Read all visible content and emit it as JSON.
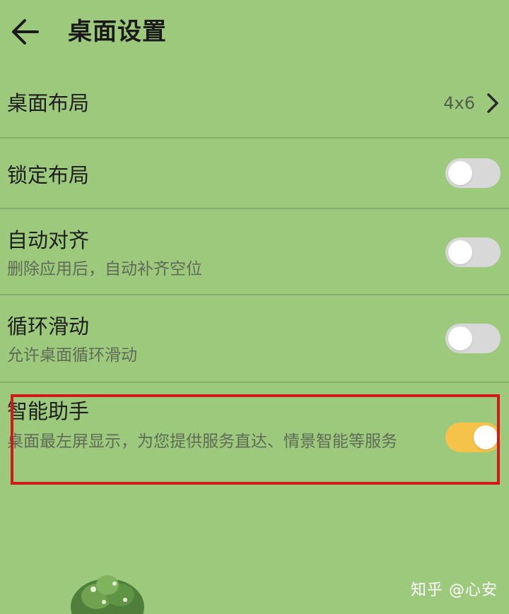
{
  "header": {
    "title": "桌面设置",
    "back_icon": "arrow-left-icon"
  },
  "settings": [
    {
      "label": "桌面布局",
      "value": "4x6",
      "icon": "chevron-right-icon"
    },
    {
      "label": "锁定布局",
      "toggle": false
    },
    {
      "label": "自动对齐",
      "subtitle": "删除应用后，自动补齐空位",
      "toggle": false
    },
    {
      "label": "循环滑动",
      "subtitle": "允许桌面循环滑动",
      "toggle": false
    },
    {
      "label": "智能助手",
      "subtitle": "桌面最左屏显示，为您提供服务直达、情景智能等服务",
      "toggle": true
    }
  ],
  "colors": {
    "background": "#9cc97c",
    "toggle_off": "#d8d8d8",
    "toggle_on": "#f5c34a",
    "highlight": "#d21a1a"
  },
  "watermark": "知乎 @心安"
}
